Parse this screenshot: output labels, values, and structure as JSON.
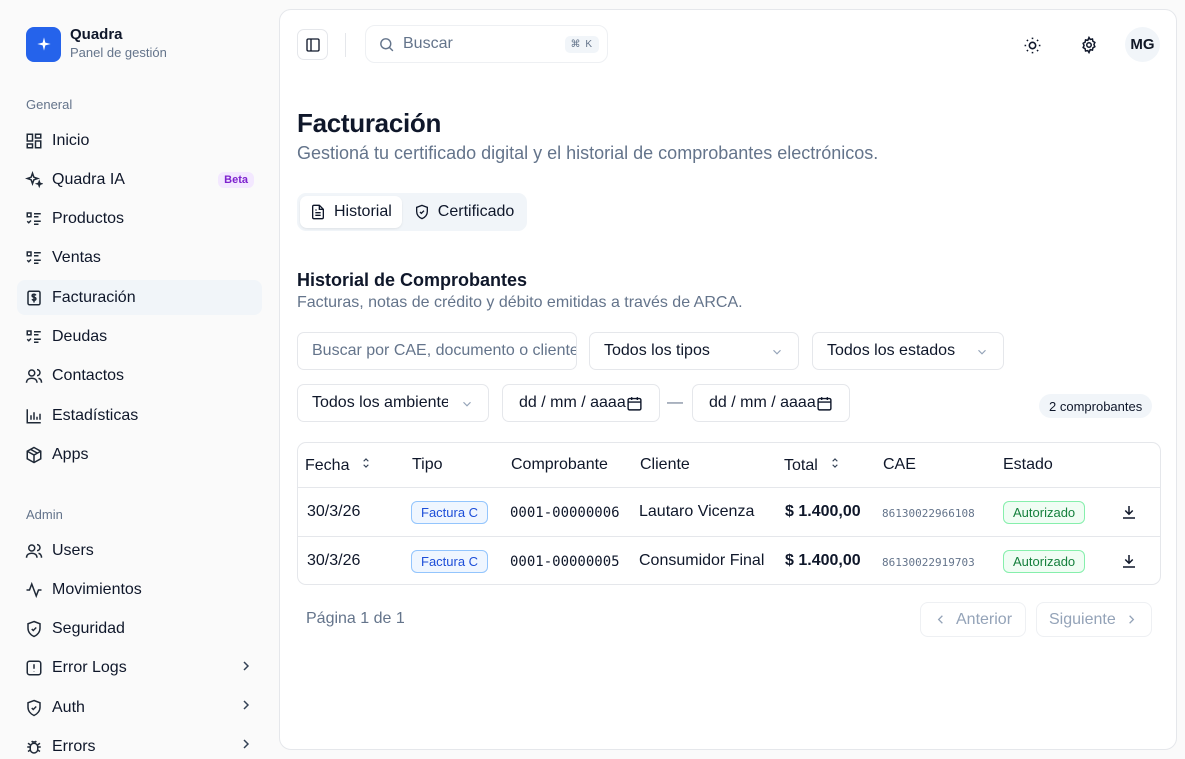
{
  "brand": {
    "name": "Quadra",
    "subtitle": "Panel de gestión"
  },
  "sidebar": {
    "general_label": "General",
    "general_items": [
      {
        "label": "Inicio",
        "icon": "dashboard-icon"
      },
      {
        "label": "Quadra IA",
        "icon": "sparkles-icon",
        "badge": "Beta"
      },
      {
        "label": "Productos",
        "icon": "list-icon"
      },
      {
        "label": "Ventas",
        "icon": "list-icon"
      },
      {
        "label": "Facturación",
        "icon": "invoice-icon",
        "active": true
      },
      {
        "label": "Deudas",
        "icon": "list-icon"
      },
      {
        "label": "Contactos",
        "icon": "users-icon"
      },
      {
        "label": "Estadísticas",
        "icon": "bar-chart-icon"
      },
      {
        "label": "Apps",
        "icon": "package-icon"
      }
    ],
    "admin_label": "Admin",
    "admin_items": [
      {
        "label": "Users",
        "icon": "users-icon"
      },
      {
        "label": "Movimientos",
        "icon": "activity-icon"
      },
      {
        "label": "Seguridad",
        "icon": "shield-icon"
      },
      {
        "label": "Error Logs",
        "icon": "alert-icon",
        "chevron": true
      },
      {
        "label": "Auth",
        "icon": "shield-icon",
        "chevron": true
      },
      {
        "label": "Errors",
        "icon": "bug-icon",
        "chevron": true
      }
    ]
  },
  "topbar": {
    "search_placeholder": "Buscar",
    "search_shortcut": "⌘ K",
    "avatar_initials": "MG"
  },
  "page": {
    "title": "Facturación",
    "subtitle": "Gestioná tu certificado digital y el historial de comprobantes electrónicos."
  },
  "tabs": [
    {
      "label": "Historial",
      "icon": "file-icon",
      "active": true
    },
    {
      "label": "Certificado",
      "icon": "shield-check-icon",
      "active": false
    }
  ],
  "section": {
    "title": "Historial de Comprobantes",
    "subtitle": "Facturas, notas de crédito y débito emitidas a través de ARCA."
  },
  "filters": {
    "search_placeholder": "Buscar por CAE, documento o cliente",
    "tipo": "Todos los tipos",
    "estado": "Todos los estados",
    "ambiente": "Todos los ambientes",
    "date_from": "dd / mm / aaaa",
    "date_to": "dd / mm / aaaa",
    "date_separator": "—",
    "count": "2 comprobantes"
  },
  "table": {
    "columns": [
      "Fecha",
      "Tipo",
      "Comprobante",
      "Cliente",
      "Total",
      "CAE",
      "Estado"
    ],
    "rows": [
      {
        "fecha": "30/3/26",
        "tipo": "Factura C",
        "comprobante": "0001-00000006",
        "cliente": "Lautaro Vicenza",
        "total": "$ 1.400,00",
        "cae": "86130022966108",
        "estado": "Autorizado"
      },
      {
        "fecha": "30/3/26",
        "tipo": "Factura C",
        "comprobante": "0001-00000005",
        "cliente": "Consumidor Final",
        "total": "$ 1.400,00",
        "cae": "86130022919703",
        "estado": "Autorizado"
      }
    ]
  },
  "pagination": {
    "text": "Página 1 de 1",
    "prev": "Anterior",
    "next": "Siguiente"
  },
  "colors": {
    "accent": "#2563eb",
    "beta_badge": "#7e22ce",
    "tipo_badge": "#1d4ed8",
    "estado_badge": "#15803d"
  }
}
